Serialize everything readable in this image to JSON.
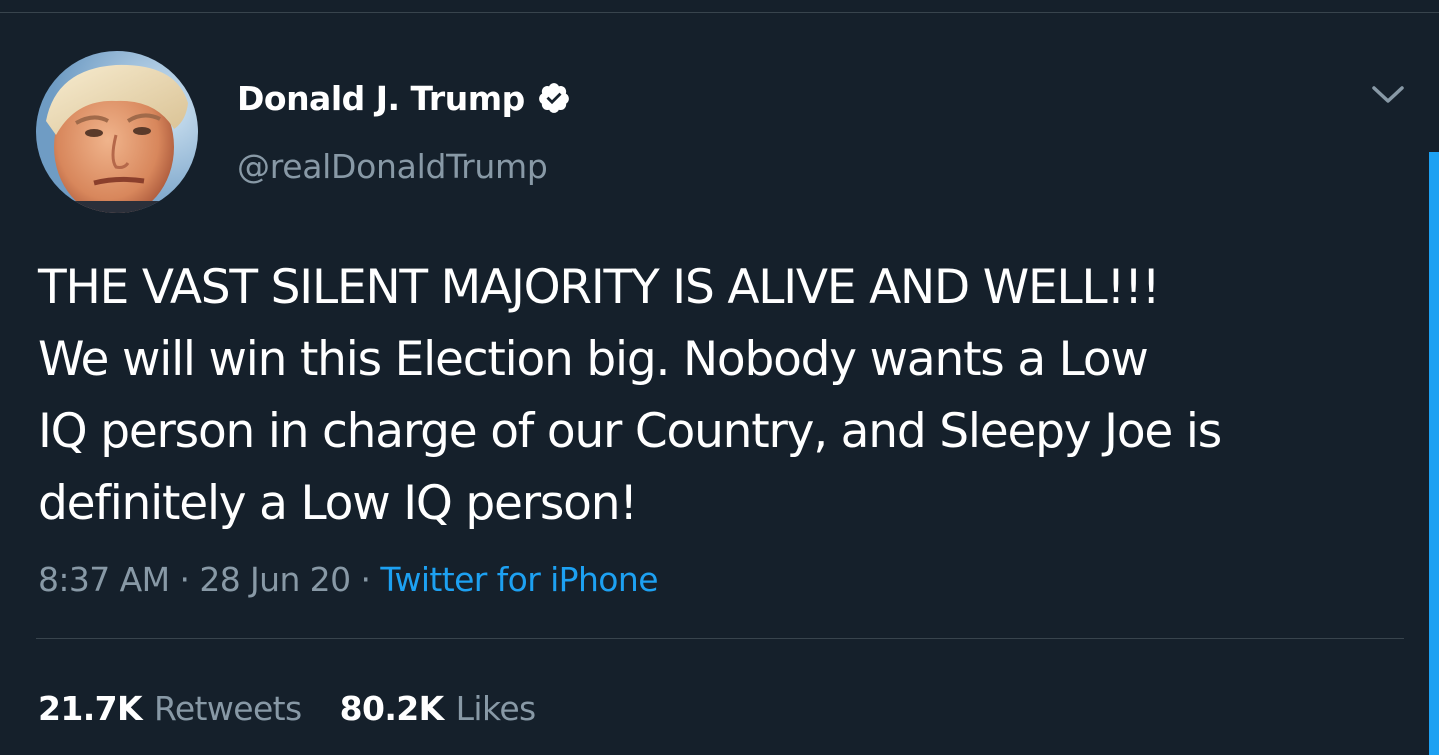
{
  "theme": {
    "background": "#15202b",
    "text_primary": "#ffffff",
    "text_secondary": "#8899a6",
    "accent": "#1da1f2",
    "divider": "#38444d"
  },
  "author": {
    "display_name": "Donald J. Trump",
    "handle": "@realDonaldTrump",
    "verified": true,
    "verified_icon": "verified-badge-icon",
    "avatar": "profile-photo"
  },
  "menu_icon": "chevron-down-icon",
  "tweet": {
    "lines": [
      "THE VAST SILENT MAJORITY IS ALIVE AND WELL!!!",
      "We will win this Election big. Nobody wants a Low",
      "IQ person in charge of our Country, and Sleepy Joe is",
      "definitely a Low IQ person!"
    ]
  },
  "meta": {
    "time": "8:37 AM",
    "separator": "·",
    "date": "28 Jun 20",
    "source": "Twitter for iPhone"
  },
  "stats": {
    "retweets_count": "21.7K",
    "retweets_label": "Retweets",
    "likes_count": "80.2K",
    "likes_label": "Likes"
  }
}
